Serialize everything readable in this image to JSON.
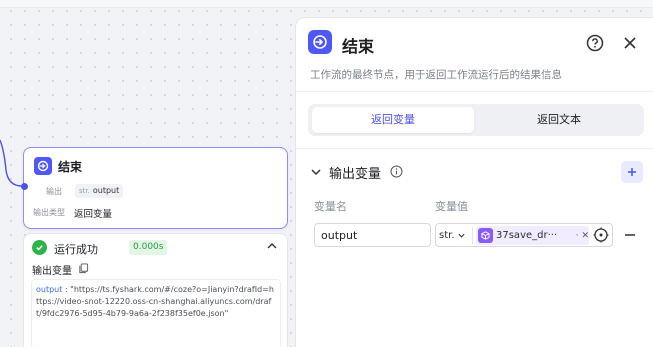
{
  "node": {
    "title": "结束",
    "output_label": "输出",
    "output_type": "str.",
    "output_name": "output",
    "output_mode_label": "输出类型",
    "output_mode_value": "返回变量"
  },
  "run": {
    "status": "运行成功",
    "duration": "0.000s",
    "output_title": "输出变量",
    "output_key": "output",
    "output_value": " : \"https://ts.fyshark.com/#/coze?o=Jianyin?drafId=https://video-snot-12220.oss-cn-shanghai.aliyuncs.com/draft/9fdc2976-5d95-4b79-9a6a-2f238f35ef0e.json\""
  },
  "panel": {
    "title": "结束",
    "description": "工作流的最终节点，用于返回工作流运行后的结果信息",
    "tabs": [
      {
        "label": "返回变量",
        "active": true
      },
      {
        "label": "返回文本",
        "active": false
      }
    ],
    "section_title": "输出变量",
    "col_name": "变量名",
    "col_value": "变量值",
    "variable": {
      "name": "output",
      "type": "str.",
      "reference": "37save_dr···",
      "reference_suffix": "·"
    }
  },
  "colors": {
    "accent": "#4d53e8",
    "success": "#2fb24a",
    "reference": "#8a5cf6"
  }
}
